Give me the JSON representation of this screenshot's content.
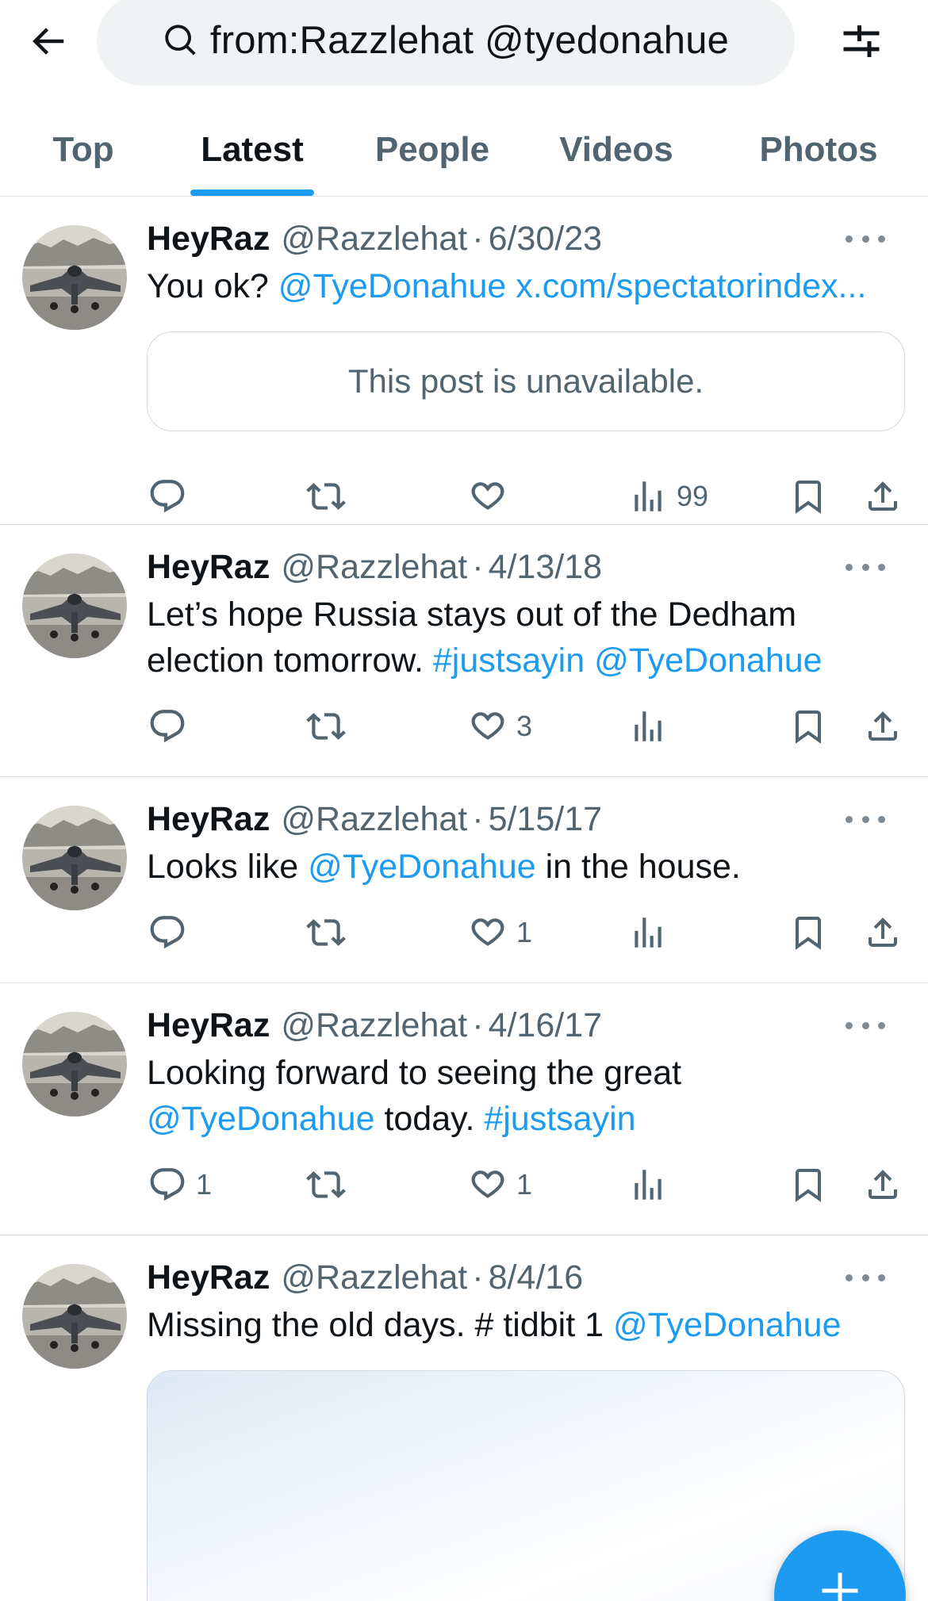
{
  "search": {
    "query": "from:Razzlehat @tyedonahue"
  },
  "tabs": [
    {
      "label": "Top"
    },
    {
      "label": "Latest"
    },
    {
      "label": "People"
    },
    {
      "label": "Videos"
    },
    {
      "label": "Photos"
    }
  ],
  "active_tab": "Latest",
  "accent_color": "#1d9bf0",
  "posts": [
    {
      "name": "HeyRaz",
      "handle": "@Razzlehat",
      "date": "6/30/23",
      "text_pre": "You ok? ",
      "mention": "@TyeDonahue",
      "link": "x.com/spectatorindex...",
      "embed_text": "This post is unavailable.",
      "views": "99"
    },
    {
      "name": "HeyRaz",
      "handle": "@Razzlehat",
      "date": "4/13/18",
      "text_pre": "Let’s hope Russia stays out of the Dedham election tomorrow. ",
      "hashtag": "#justsayin",
      "mention": "@TyeDonahue",
      "likes": "3"
    },
    {
      "name": "HeyRaz",
      "handle": "@Razzlehat",
      "date": "5/15/17",
      "text_pre": "Looks like ",
      "mention": "@TyeDonahue",
      "text_post": " in the house.",
      "likes": "1"
    },
    {
      "name": "HeyRaz",
      "handle": "@Razzlehat",
      "date": "4/16/17",
      "text_pre": "Looking forward to seeing the great ",
      "mention": "@TyeDonahue",
      "text_mid": " today. ",
      "hashtag": "#justsayin",
      "replies": "1",
      "likes": "1"
    },
    {
      "name": "HeyRaz",
      "handle": "@Razzlehat",
      "date": "8/4/16",
      "text_pre": "Missing the old days. # tidbit 1 ",
      "mention": "@TyeDonahue"
    }
  ],
  "separator": "·",
  "icons": [
    "back-arrow-icon",
    "search-icon",
    "filter-icon",
    "more-icon",
    "reply-icon",
    "repost-icon",
    "like-icon",
    "views-icon",
    "bookmark-icon",
    "share-icon",
    "plus-icon"
  ]
}
